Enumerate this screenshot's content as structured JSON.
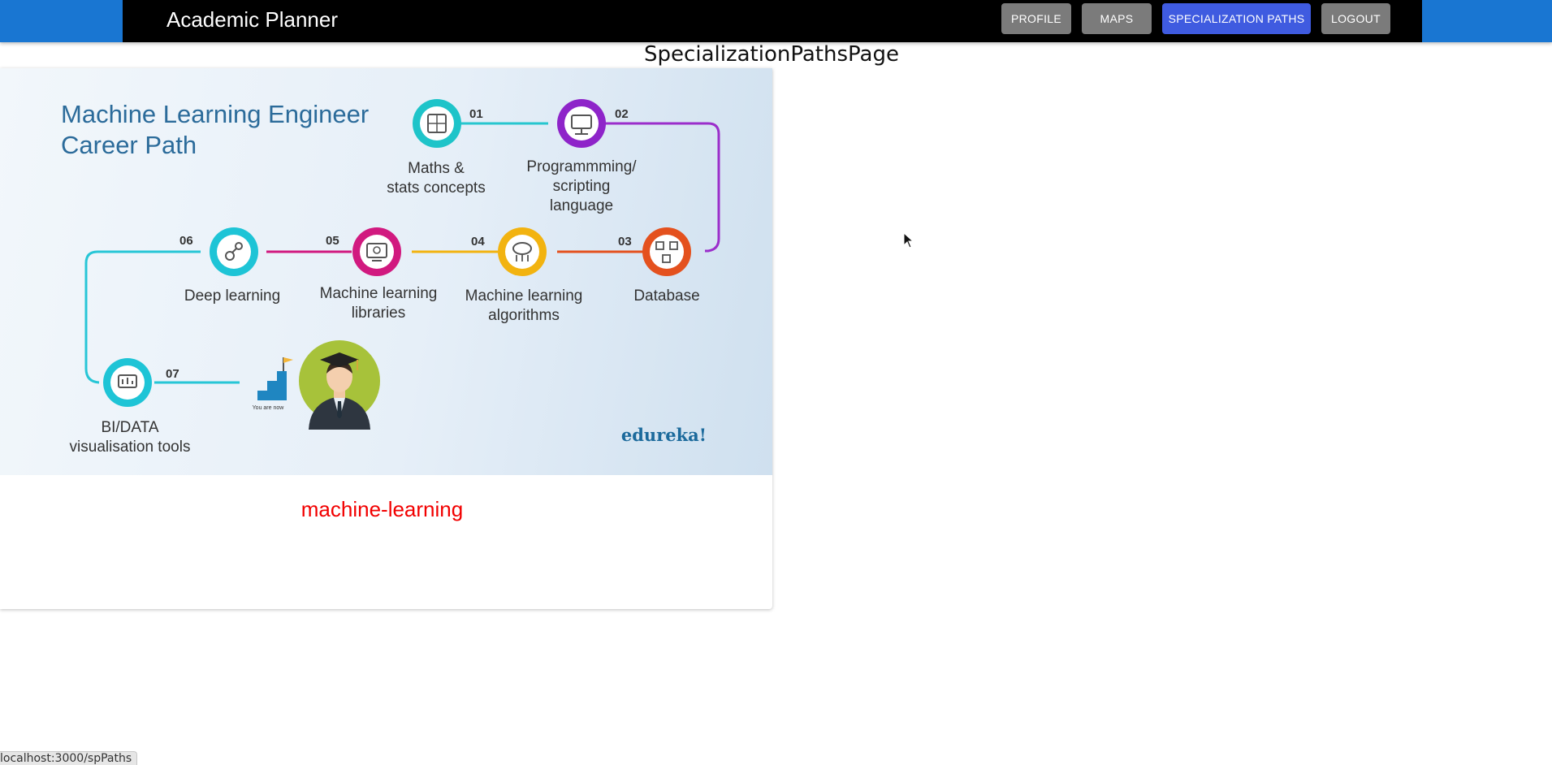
{
  "app": {
    "title": "Academic Planner"
  },
  "nav": {
    "profile": "PROFILE",
    "maps": "MAPS",
    "specialization_paths": "SPECIALIZATION PATHS",
    "logout": "LOGOUT"
  },
  "page": {
    "heading": "SpecializationPathsPage"
  },
  "card": {
    "label": "machine-learning",
    "image": {
      "title_line1": "Machine Learning Engineer",
      "title_line2": "Career Path",
      "brand": "edureka!",
      "caption": "You are now",
      "steps": [
        {
          "num": "01",
          "lines": [
            "Maths &",
            "stats concepts"
          ],
          "color": "#1ec4c9"
        },
        {
          "num": "02",
          "lines": [
            "Programmming/",
            "scripting",
            "language"
          ],
          "color": "#8e24c9"
        },
        {
          "num": "03",
          "lines": [
            "Database"
          ],
          "color": "#e4511e"
        },
        {
          "num": "04",
          "lines": [
            "Machine learning",
            "algorithms"
          ],
          "color": "#f2b310"
        },
        {
          "num": "05",
          "lines": [
            "Machine learning",
            "libraries"
          ],
          "color": "#d1197f"
        },
        {
          "num": "06",
          "lines": [
            "Deep learning"
          ],
          "color": "#1ec4d6"
        },
        {
          "num": "07",
          "lines": [
            "BI/DATA",
            "visualisation tools"
          ],
          "color": "#1ec4d6"
        }
      ]
    }
  },
  "status_bar": {
    "url": "localhost:3000/spPaths"
  }
}
